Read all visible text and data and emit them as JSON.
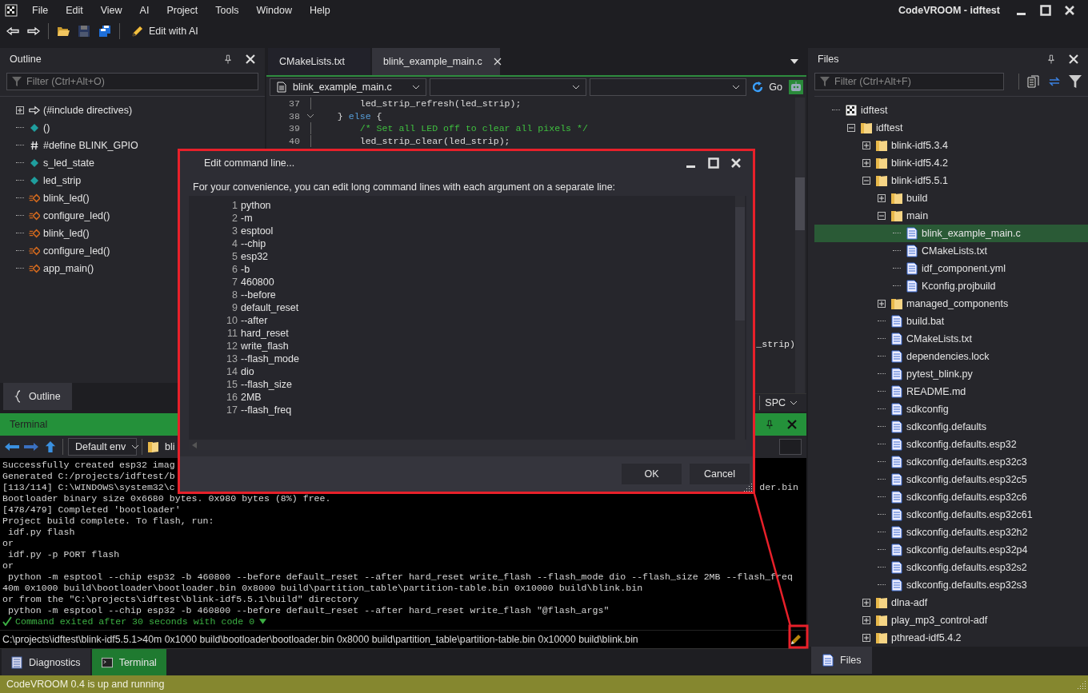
{
  "window": {
    "title": "CodeVROOM - idftest"
  },
  "menu": [
    "File",
    "Edit",
    "View",
    "AI",
    "Project",
    "Tools",
    "Window",
    "Help"
  ],
  "toolbar": {
    "items": [
      {
        "kind": "back",
        "disabled": false
      },
      {
        "kind": "forward",
        "disabled": false
      },
      {
        "kind": "open",
        "disabled": false
      },
      {
        "kind": "save",
        "disabled": true
      },
      {
        "kind": "save_all",
        "disabled": false
      }
    ],
    "ai_button": "Edit with AI"
  },
  "outline": {
    "title": "Outline",
    "filter": {
      "placeholder": "Filter (Ctrl+Alt+O)"
    },
    "items": [
      {
        "label": "(#include directives)",
        "kind": "include",
        "has_children": true
      },
      {
        "label": "()",
        "kind": "variable",
        "has_children": false
      },
      {
        "label": "#define BLINK_GPIO",
        "kind": "define",
        "has_children": false
      },
      {
        "label": "s_led_state",
        "kind": "variable",
        "has_children": false
      },
      {
        "label": "led_strip",
        "kind": "variable",
        "has_children": false
      },
      {
        "label": "blink_led()",
        "kind": "function",
        "has_children": false
      },
      {
        "label": "configure_led()",
        "kind": "function",
        "has_children": false
      },
      {
        "label": "blink_led()",
        "kind": "function",
        "has_children": false
      },
      {
        "label": "configure_led()",
        "kind": "function",
        "has_children": false
      },
      {
        "label": "app_main()",
        "kind": "function",
        "has_children": false
      }
    ],
    "tab": "Outline"
  },
  "editor": {
    "tabs": [
      {
        "label": "CMakeLists.txt",
        "selected": false
      },
      {
        "label": "blink_example_main.c",
        "selected": true
      }
    ],
    "file_dropdown": "blink_example_main.c",
    "go_button": "Go",
    "lines": [
      {
        "number": "37",
        "fold": false,
        "tokens": [
          {
            "text": "       led_strip_refresh(led_strip);",
            "kind": "plain"
          }
        ]
      },
      {
        "number": "38",
        "fold": true,
        "tokens": [
          {
            "text": "   } ",
            "kind": "plain"
          },
          {
            "text": "else",
            "kind": "keyword"
          },
          {
            "text": " {",
            "kind": "plain"
          }
        ]
      },
      {
        "number": "39",
        "fold": false,
        "tokens": [
          {
            "text": "       /* Set all LED off to clear all pixels */",
            "kind": "comment"
          }
        ]
      },
      {
        "number": "40",
        "fold": false,
        "tokens": [
          {
            "text": "       led_strip_clear(led_strip);",
            "kind": "plain"
          }
        ]
      }
    ],
    "fragment": "_strip)",
    "indent_mode": "SPC"
  },
  "terminal": {
    "title": "Terminal",
    "env": "Default env",
    "path_partial": "bli",
    "output": [
      {
        "text": "Successfully created esp32 imag",
        "kind": "plain"
      },
      {
        "text": "Generated C:/projects/idftest/b",
        "kind": "plain"
      },
      {
        "text": "[113/114] C:\\WINDOWS\\system32\\c",
        "tail": "der.bin",
        "kind": "plain"
      },
      {
        "text": "Bootloader binary size 0x6680 bytes. 0x980 bytes (8%) free.",
        "kind": "plain"
      },
      {
        "text": "[478/479] Completed 'bootloader'",
        "kind": "plain"
      },
      {
        "text": "Project build complete. To flash, run:",
        "kind": "plain"
      },
      {
        "text": " idf.py flash",
        "kind": "plain"
      },
      {
        "text": "or",
        "kind": "plain"
      },
      {
        "text": " idf.py -p PORT flash",
        "kind": "plain"
      },
      {
        "text": "or",
        "kind": "plain"
      },
      {
        "text": " python -m esptool --chip esp32 -b 460800 --before default_reset --after hard_reset write_flash --flash_mode dio --flash_size 2MB --flash_freq",
        "kind": "plain"
      },
      {
        "text": "40m 0x1000 build\\bootloader\\bootloader.bin 0x8000 build\\partition_table\\partition-table.bin 0x10000 build\\blink.bin",
        "kind": "plain"
      },
      {
        "text": "or from the \"C:\\projects\\idftest\\blink-idf5.5.1\\build\" directory",
        "kind": "plain"
      },
      {
        "text": " python -m esptool --chip esp32 -b 460800 --before default_reset --after hard_reset write_flash \"@flash_args\"",
        "kind": "plain"
      },
      {
        "text": "Command exited after 30 seconds with code 0",
        "kind": "status"
      }
    ],
    "prompt": "C:\\projects\\idftest\\blink-idf5.5.1>40m 0x1000 build\\bootloader\\bootloader.bin 0x8000 build\\partition_table\\partition-table.bin 0x10000 build\\blink.bin",
    "bottom_tabs": [
      {
        "label": "Diagnostics",
        "kind": "diagnostics",
        "selected": false
      },
      {
        "label": "Terminal",
        "kind": "terminal",
        "selected": true
      }
    ]
  },
  "files": {
    "title": "Files",
    "filter": {
      "placeholder": "Filter (Ctrl+Alt+F)"
    },
    "tree": [
      {
        "name": "idftest",
        "kind": "project",
        "selected": false,
        "children": [
          {
            "name": "idftest",
            "kind": "folder",
            "expanded": true,
            "selected": false,
            "children": [
              {
                "name": "blink-idf5.3.4",
                "kind": "folder",
                "expanded": false,
                "selected": false
              },
              {
                "name": "blink-idf5.4.2",
                "kind": "folder",
                "expanded": false,
                "selected": false
              },
              {
                "name": "blink-idf5.5.1",
                "kind": "folder",
                "expanded": true,
                "selected": false,
                "children": [
                  {
                    "name": "build",
                    "kind": "folder",
                    "expanded": false,
                    "selected": false
                  },
                  {
                    "name": "main",
                    "kind": "folder",
                    "expanded": true,
                    "selected": false,
                    "children": [
                      {
                        "name": "blink_example_main.c",
                        "kind": "file",
                        "selected": true
                      },
                      {
                        "name": "CMakeLists.txt",
                        "kind": "file",
                        "selected": false
                      },
                      {
                        "name": "idf_component.yml",
                        "kind": "file",
                        "selected": false
                      },
                      {
                        "name": "Kconfig.projbuild",
                        "kind": "file",
                        "selected": false
                      }
                    ]
                  },
                  {
                    "name": "managed_components",
                    "kind": "folder",
                    "expanded": false,
                    "selected": false
                  },
                  {
                    "name": "build.bat",
                    "kind": "file",
                    "selected": false
                  },
                  {
                    "name": "CMakeLists.txt",
                    "kind": "file",
                    "selected": false
                  },
                  {
                    "name": "dependencies.lock",
                    "kind": "file",
                    "selected": false
                  },
                  {
                    "name": "pytest_blink.py",
                    "kind": "file",
                    "selected": false
                  },
                  {
                    "name": "README.md",
                    "kind": "file",
                    "selected": false
                  },
                  {
                    "name": "sdkconfig",
                    "kind": "file",
                    "selected": false
                  },
                  {
                    "name": "sdkconfig.defaults",
                    "kind": "file",
                    "selected": false
                  },
                  {
                    "name": "sdkconfig.defaults.esp32",
                    "kind": "file",
                    "selected": false
                  },
                  {
                    "name": "sdkconfig.defaults.esp32c3",
                    "kind": "file",
                    "selected": false
                  },
                  {
                    "name": "sdkconfig.defaults.esp32c5",
                    "kind": "file",
                    "selected": false
                  },
                  {
                    "name": "sdkconfig.defaults.esp32c6",
                    "kind": "file",
                    "selected": false
                  },
                  {
                    "name": "sdkconfig.defaults.esp32c61",
                    "kind": "file",
                    "selected": false
                  },
                  {
                    "name": "sdkconfig.defaults.esp32h2",
                    "kind": "file",
                    "selected": false
                  },
                  {
                    "name": "sdkconfig.defaults.esp32p4",
                    "kind": "file",
                    "selected": false
                  },
                  {
                    "name": "sdkconfig.defaults.esp32s2",
                    "kind": "file",
                    "selected": false
                  },
                  {
                    "name": "sdkconfig.defaults.esp32s3",
                    "kind": "file",
                    "selected": false
                  }
                ]
              },
              {
                "name": "dlna-adf",
                "kind": "folder",
                "expanded": false,
                "selected": false
              },
              {
                "name": "play_mp3_control-adf",
                "kind": "folder",
                "expanded": false,
                "selected": false
              },
              {
                "name": "pthread-idf5.4.2",
                "kind": "folder",
                "expanded": false,
                "selected": false
              }
            ]
          }
        ]
      }
    ],
    "tab": "Files"
  },
  "dialog": {
    "title": "Edit command line...",
    "description": "For your convenience, you can edit long command lines with each argument on a separate line:",
    "lines": [
      {
        "number": "1",
        "text": "python"
      },
      {
        "number": "2",
        "text": "-m"
      },
      {
        "number": "3",
        "text": "esptool"
      },
      {
        "number": "4",
        "text": "--chip"
      },
      {
        "number": "5",
        "text": "esp32"
      },
      {
        "number": "6",
        "text": "-b"
      },
      {
        "number": "7",
        "text": "460800"
      },
      {
        "number": "8",
        "text": "--before"
      },
      {
        "number": "9",
        "text": "default_reset"
      },
      {
        "number": "10",
        "text": "--after"
      },
      {
        "number": "11",
        "text": "hard_reset"
      },
      {
        "number": "12",
        "text": "write_flash"
      },
      {
        "number": "13",
        "text": "--flash_mode"
      },
      {
        "number": "14",
        "text": "dio"
      },
      {
        "number": "15",
        "text": "--flash_size"
      },
      {
        "number": "16",
        "text": "2MB"
      },
      {
        "number": "17",
        "text": "--flash_freq"
      }
    ],
    "buttons": [
      "OK",
      "Cancel"
    ]
  },
  "status_bar": {
    "message": "CodeVROOM 0.4 is up and running"
  }
}
